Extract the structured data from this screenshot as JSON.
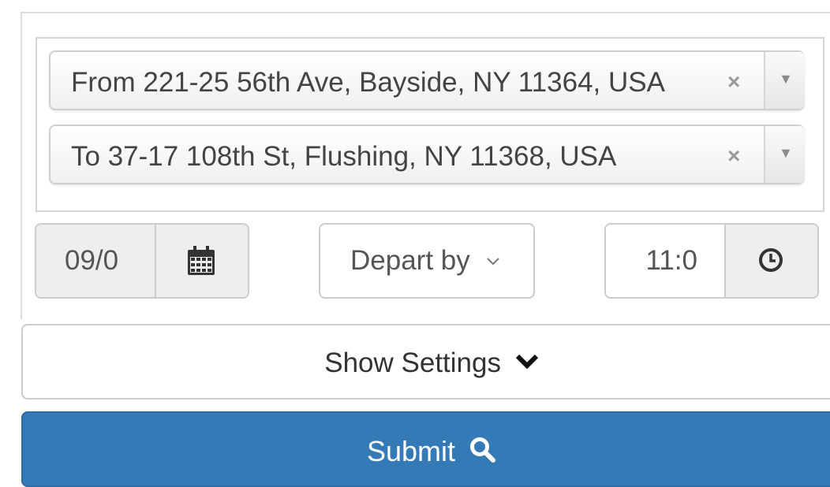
{
  "route": {
    "from": {
      "value": "From 221-25 56th Ave, Bayside, NY 11364, USA",
      "clear_label": "×",
      "caret_label": "▼"
    },
    "to": {
      "value": "To 37-17 108th St, Flushing, NY 11368, USA",
      "clear_label": "×",
      "caret_label": "▼"
    }
  },
  "date": {
    "value": "09/0",
    "icon": "calendar-icon"
  },
  "depart_mode": {
    "selected": "Depart by",
    "icon": "chevron-down-icon"
  },
  "time": {
    "value": "11:0",
    "icon": "clock-icon"
  },
  "settings_button": {
    "label": "Show Settings",
    "icon": "chevron-down-icon"
  },
  "submit_button": {
    "label": "Submit",
    "icon": "search-icon",
    "color": "#337ab7"
  }
}
